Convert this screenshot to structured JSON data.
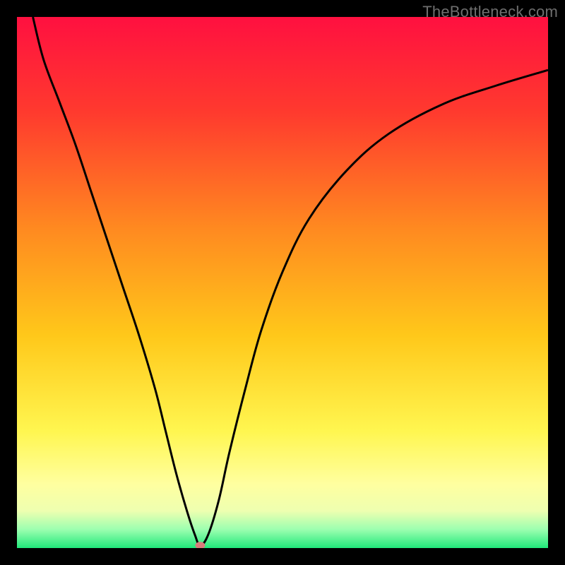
{
  "attribution": "TheBottleneck.com",
  "colors": {
    "frame": "#000000",
    "attribution_text": "#6e6e6e",
    "curve": "#000000",
    "marker_fill": "#d97b7b",
    "gradient_stops": [
      {
        "offset": 0.0,
        "color": "#ff1040"
      },
      {
        "offset": 0.18,
        "color": "#ff3a2e"
      },
      {
        "offset": 0.4,
        "color": "#ff8a20"
      },
      {
        "offset": 0.6,
        "color": "#ffc81a"
      },
      {
        "offset": 0.78,
        "color": "#fff650"
      },
      {
        "offset": 0.88,
        "color": "#ffffa0"
      },
      {
        "offset": 0.93,
        "color": "#eeffb0"
      },
      {
        "offset": 0.965,
        "color": "#9cffb0"
      },
      {
        "offset": 1.0,
        "color": "#20e87a"
      }
    ]
  },
  "chart_data": {
    "type": "line",
    "title": "",
    "xlabel": "",
    "ylabel": "",
    "xlim": [
      0,
      100
    ],
    "ylim": [
      0,
      100
    ],
    "grid": false,
    "legend": false,
    "series": [
      {
        "name": "bottleneck-curve",
        "x": [
          3,
          5,
          8,
          11,
          14,
          17,
          20,
          23,
          26,
          28,
          30,
          32,
          33.5,
          34.5,
          36,
          38,
          40,
          43,
          46,
          50,
          55,
          62,
          70,
          80,
          90,
          100
        ],
        "values": [
          100,
          92,
          84,
          76,
          67,
          58,
          49,
          40,
          30,
          22,
          14,
          7,
          2.5,
          0.5,
          2.5,
          9,
          18,
          30,
          41,
          52,
          62,
          71,
          78,
          83.5,
          87,
          90
        ]
      }
    ],
    "annotations": [
      {
        "name": "minimum-marker",
        "x": 34.5,
        "y": 0.5
      }
    ]
  }
}
